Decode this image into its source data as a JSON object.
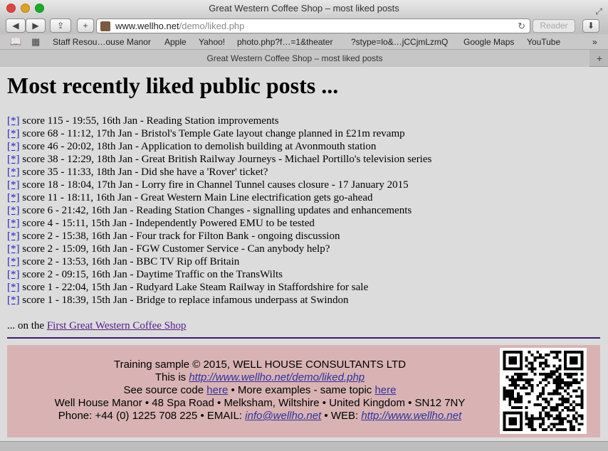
{
  "window": {
    "title": "Great Western Coffee Shop – most liked posts"
  },
  "toolbar": {
    "url_host": "www.wellho.net",
    "url_path": "/demo/liked.php",
    "reader_label": "Reader"
  },
  "bookmarks": [
    "Staff Resou…ouse Manor",
    "Apple",
    "Yahoo!",
    "photo.php?f…=1&theater",
    "?stype=lo&…jCCjmLzmQ",
    "Google Maps",
    "YouTube"
  ],
  "tab": {
    "label": "Great Western Coffee Shop – most liked posts"
  },
  "page": {
    "heading": "Most recently liked public posts ...",
    "link_marker": "[*]",
    "posts": [
      " score 115 - 19:55, 16th Jan - Reading Station improvements",
      " score 68 - 11:12, 17th Jan - Bristol's Temple Gate layout change planned in £21m revamp",
      " score 46 - 20:02, 18th Jan - Application to demolish building at Avonmouth station",
      " score 38 - 12:29, 18th Jan - Great British Railway Journeys - Michael Portillo's television series",
      " score 35 - 11:33, 18th Jan - Did she have a 'Rover' ticket?",
      " score 18 - 18:04, 17th Jan - Lorry fire in Channel Tunnel causes closure - 17 January 2015",
      " score 11 - 18:11, 16th Jan - Great Western Main Line electrification gets go-ahead",
      " score 6 - 21:42, 16th Jan - Reading Station Changes - signalling updates and enhancements",
      " score 4 - 15:11, 15th Jan - Independently Powered EMU to be tested",
      " score 2 - 15:38, 16th Jan - Four track for Filton Bank - ongoing discussion",
      " score 2 - 15:09, 16th Jan - FGW Customer Service - Can anybody help?",
      " score 2 - 13:53, 16th Jan - BBC TV Rip off Britain",
      " score 2 - 09:15, 16th Jan - Daytime Traffic on the TransWilts",
      " score 1 - 22:04, 15th Jan - Rudyard Lake Steam Railway in Staffordshire for sale",
      " score 1 - 18:39, 15th Jan - Bridge to replace infamous underpass at Swindon"
    ],
    "on_the_prefix": "... on the ",
    "forum_link": "First Great Western Coffee Shop "
  },
  "footer": {
    "line1": "Training sample © 2015, WELL HOUSE CONSULTANTS LTD",
    "line2_prefix": "This is ",
    "line2_link": "http://www.wellho.net/demo/liked.php",
    "line3_prefix": "See source code ",
    "line3_link1": "here",
    "line3_mid": " • More examples - same topic ",
    "line3_link2": "here",
    "line4": "Well House Manor • 48 Spa Road • Melksham, Wiltshire • United Kingdom • SN12 7NY",
    "line5_prefix": "Phone: +44 (0) 1225 708 225 • EMAIL: ",
    "line5_email": "info@wellho.net",
    "line5_mid": " • WEB: ",
    "line5_web": "http://www.wellho.net"
  }
}
